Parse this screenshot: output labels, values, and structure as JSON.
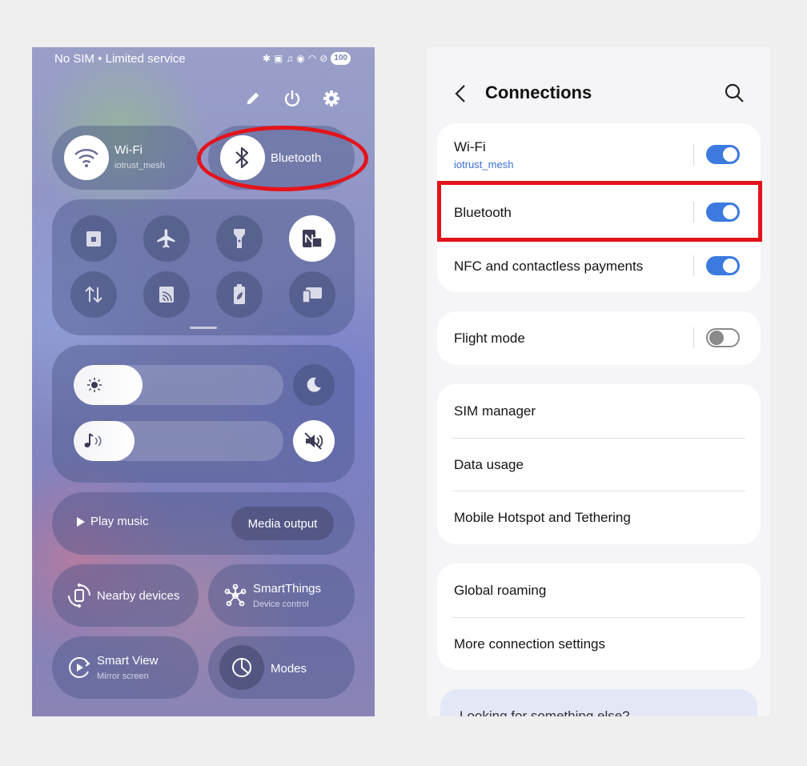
{
  "quick_panel": {
    "status_bar": {
      "carrier_text": "No SIM • Limited service",
      "battery": "100",
      "icons": [
        "bluetooth-icon",
        "nfc-icon",
        "mute-icon",
        "location-icon",
        "wifi-icon",
        "dnd-icon"
      ]
    },
    "top_actions": [
      "edit-icon",
      "power-icon",
      "settings-icon"
    ],
    "wifi_tile": {
      "title": "Wi-Fi",
      "subtitle": "iotrust_mesh"
    },
    "bluetooth_tile": {
      "title": "Bluetooth"
    },
    "toggles": [
      "secure-folder-icon",
      "airplane-icon",
      "flashlight-icon",
      "nfc-icon",
      "mobile-data-icon",
      "cast-icon",
      "power-saving-icon",
      "dex-icon"
    ],
    "brightness_level": 0.23,
    "volume_level": 0.19,
    "media": {
      "play_label": "Play music",
      "output_label": "Media output"
    },
    "nearby": {
      "title": "Nearby devices"
    },
    "smartthings": {
      "title": "SmartThings",
      "subtitle": "Device control"
    },
    "smart_view": {
      "title": "Smart View",
      "subtitle": "Mirror screen"
    },
    "modes": {
      "title": "Modes"
    }
  },
  "connections": {
    "title": "Connections",
    "wifi": {
      "label": "Wi-Fi",
      "network": "iotrust_mesh",
      "on": true
    },
    "bluetooth": {
      "label": "Bluetooth",
      "on": true
    },
    "nfc": {
      "label": "NFC and contactless payments",
      "on": true
    },
    "flight": {
      "label": "Flight mode",
      "on": false
    },
    "sim_manager": "SIM manager",
    "data_usage": "Data usage",
    "hotspot": "Mobile Hotspot and Tethering",
    "global_roaming": "Global roaming",
    "more_settings": "More connection settings",
    "looking_for": "Looking for something else?"
  },
  "colors": {
    "accent": "#3c7ae0",
    "highlight": "#e4131b"
  }
}
